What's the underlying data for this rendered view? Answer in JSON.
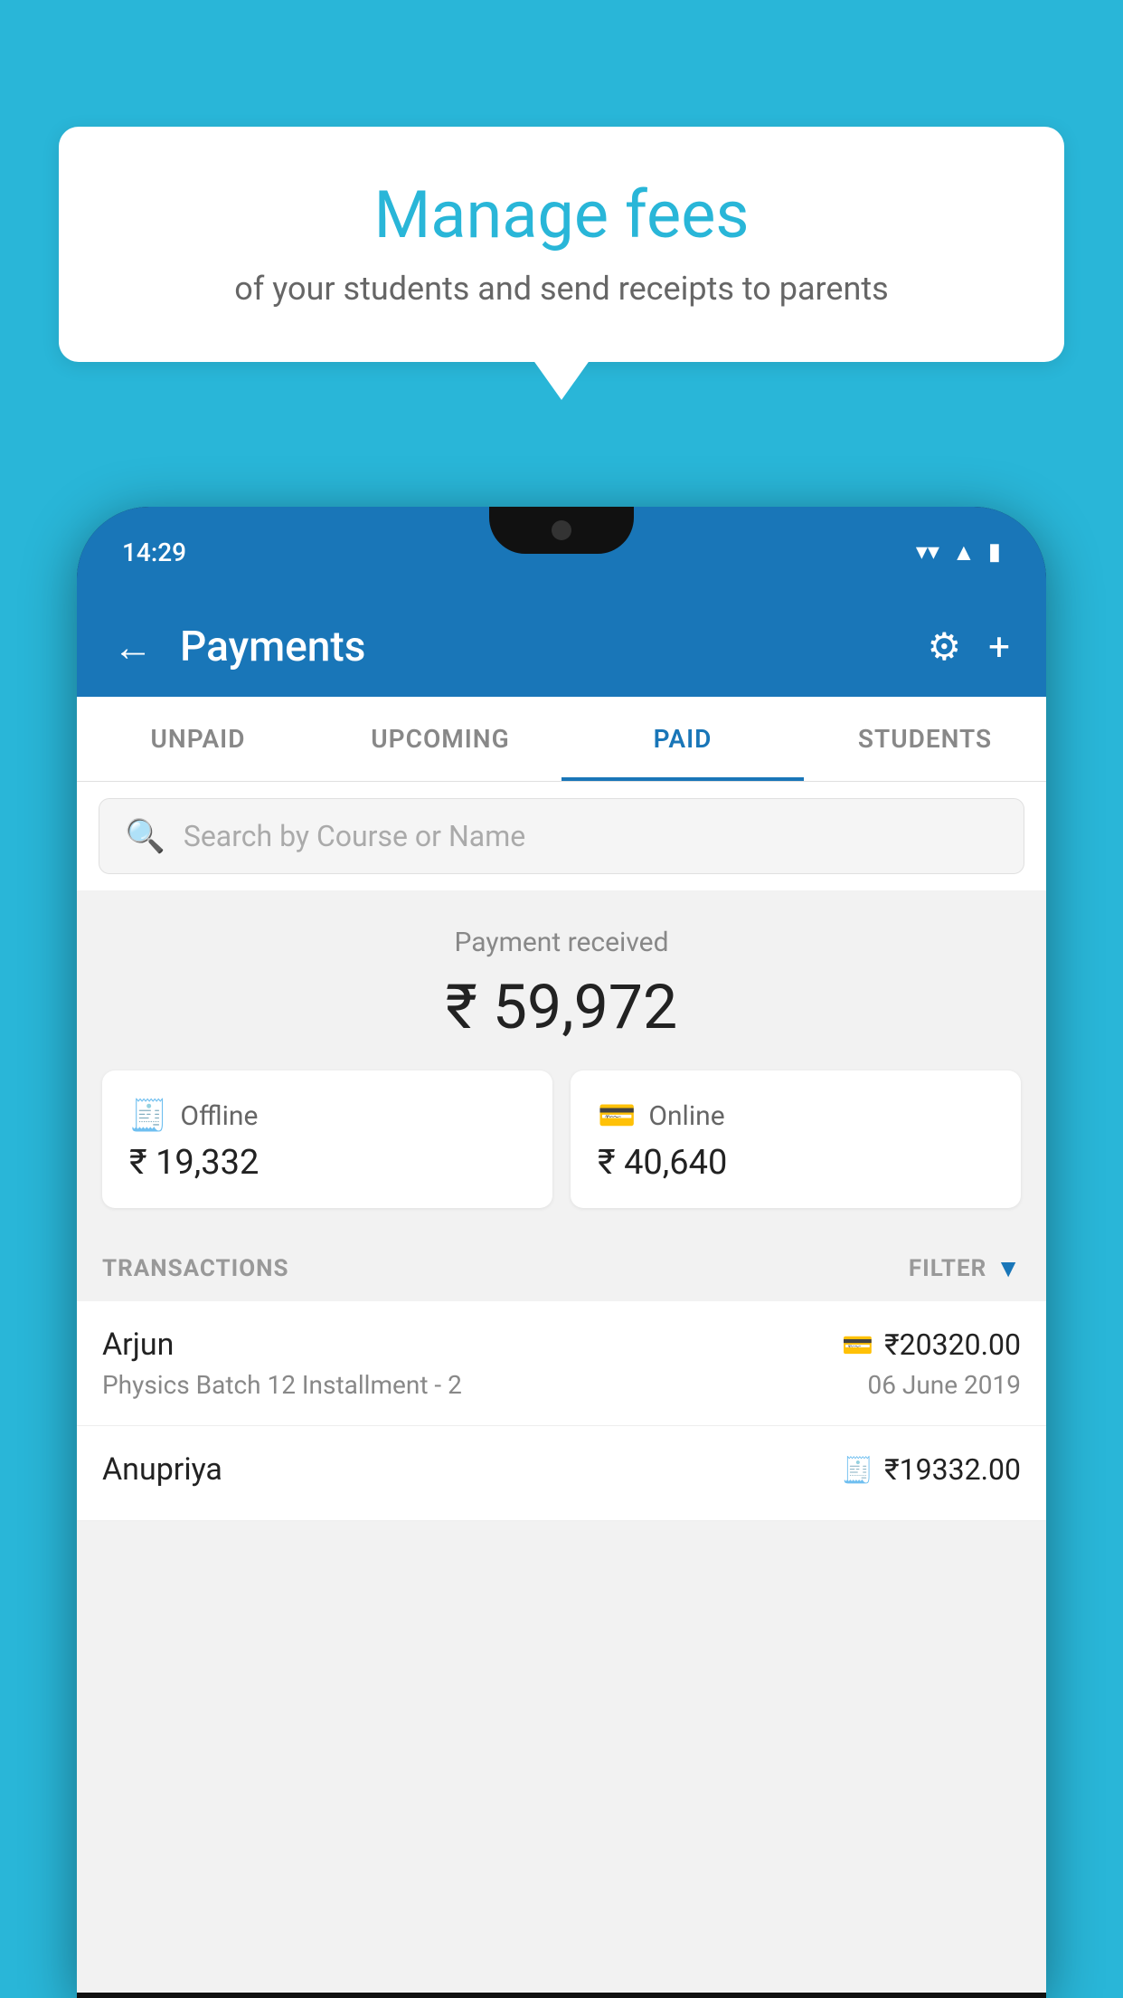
{
  "background_color": "#29b6d8",
  "speech_bubble": {
    "headline": "Manage fees",
    "subline": "of your students and send receipts to parents"
  },
  "status_bar": {
    "time": "14:29",
    "icons": [
      "wifi",
      "signal",
      "battery"
    ]
  },
  "header": {
    "title": "Payments",
    "back_label": "←",
    "settings_icon": "⚙",
    "add_icon": "+"
  },
  "tabs": [
    {
      "label": "UNPAID",
      "active": false
    },
    {
      "label": "UPCOMING",
      "active": false
    },
    {
      "label": "PAID",
      "active": true
    },
    {
      "label": "STUDENTS",
      "active": false
    }
  ],
  "search": {
    "placeholder": "Search by Course or Name"
  },
  "payment_summary": {
    "label": "Payment received",
    "amount": "₹ 59,972",
    "offline": {
      "type": "Offline",
      "amount": "₹ 19,332"
    },
    "online": {
      "type": "Online",
      "amount": "₹ 40,640"
    }
  },
  "transactions": {
    "header": "TRANSACTIONS",
    "filter_label": "FILTER",
    "items": [
      {
        "name": "Arjun",
        "course": "Physics Batch 12 Installment - 2",
        "amount": "₹20320.00",
        "date": "06 June 2019",
        "payment_method": "card"
      },
      {
        "name": "Anupriya",
        "course": "",
        "amount": "₹19332.00",
        "date": "",
        "payment_method": "cash"
      }
    ]
  }
}
